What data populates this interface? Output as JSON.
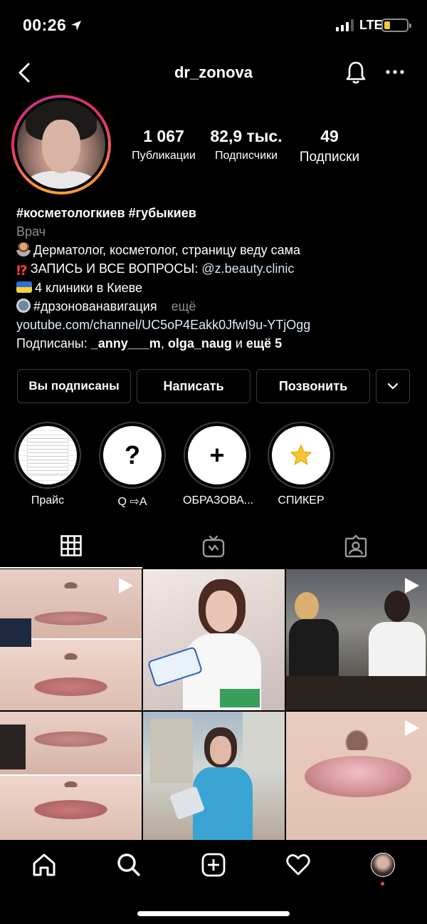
{
  "status_bar": {
    "time": "00:26",
    "network": "LTE",
    "battery_color": "#f6c645"
  },
  "header": {
    "username": "dr_zonova"
  },
  "stats": [
    {
      "value": "1 067",
      "label": "Публикации"
    },
    {
      "value": "82,9 тыс.",
      "label": "Подписчики"
    },
    {
      "value": "49",
      "label": "Подписки"
    }
  ],
  "bio": {
    "name": "#косметологкиев #губыкиев",
    "category": "Врач",
    "line1": "Дерматолог, косметолог, страницу веду сама",
    "line2_prefix": "ЗАПИСЬ И ВСЕ ВОПРОСЫ: ",
    "line2_mention": "@z.beauty.clinic",
    "line3": "4 клиники в Киеве",
    "line4": "#дрзонованавигация",
    "more": "ещё",
    "link": "youtube.com/channel/UC5oP4Eakk0JfwI9u-YTjOgg",
    "followed_by_prefix": "Подписаны: ",
    "followed_by_user1": "_anny___m",
    "followed_by_sep": ", ",
    "followed_by_user2": "olga_naug",
    "followed_by_and": " и ",
    "followed_by_more": "ещё 5"
  },
  "buttons": {
    "following": "Вы подписаны",
    "message": "Написать",
    "call": "Позвонить"
  },
  "highlights": [
    {
      "label": "Прайс",
      "icon": "document-thumbnail"
    },
    {
      "label": "Q ⇨A",
      "icon": "?"
    },
    {
      "label": "ОБРАЗОВА...",
      "icon": "+"
    },
    {
      "label": "СПИКЕР",
      "icon": "star-icon"
    }
  ],
  "tabs": [
    "grid-icon",
    "igtv-icon",
    "tagged-icon"
  ],
  "colors": {
    "background": "#000000",
    "story_ring": "#e1306c",
    "notification_dot": "#ed4956"
  }
}
